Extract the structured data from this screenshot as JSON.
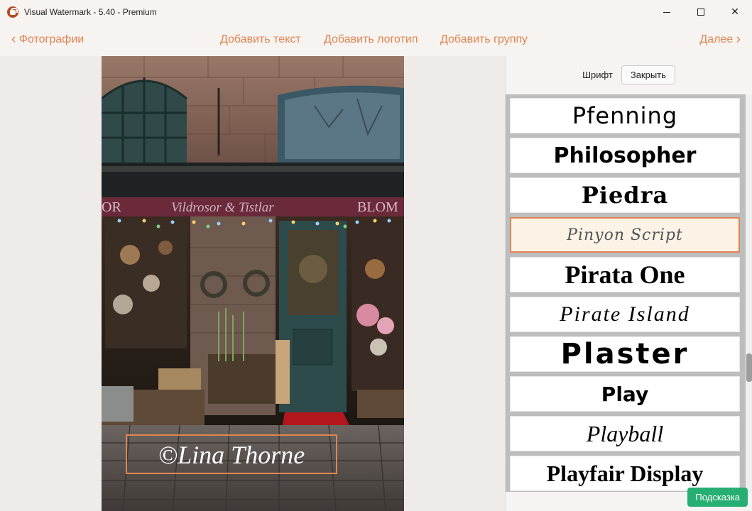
{
  "window": {
    "title": "Visual Watermark - 5.40 - Premium",
    "minimize": "–",
    "maximize": "□",
    "close": "✕"
  },
  "nav": {
    "back_label": "Фотографии",
    "add_text": "Добавить текст",
    "add_logo": "Добавить логотип",
    "add_group": "Добавить группу",
    "next_label": "Далее"
  },
  "photo": {
    "shop_sign": "Vildrosor & Tistlar",
    "sign_left": "OR",
    "sign_right": "BLOM",
    "watermark": "©Lina Thorne"
  },
  "panel": {
    "font_label": "Шрифт",
    "close_label": "Закрыть",
    "fonts": [
      "Pfenning",
      "Philosopher",
      "Piedra",
      "Pinyon Script",
      "Pirata One",
      "Pirate Island",
      "Plaster",
      "Play",
      "Playball",
      "Playfair Display"
    ],
    "selected_font": "Pinyon Script",
    "hint_label": "Подсказка"
  },
  "colors": {
    "accent": "#e08552",
    "hint_green": "#27ae72",
    "selected_bg": "#fbf4e6"
  }
}
